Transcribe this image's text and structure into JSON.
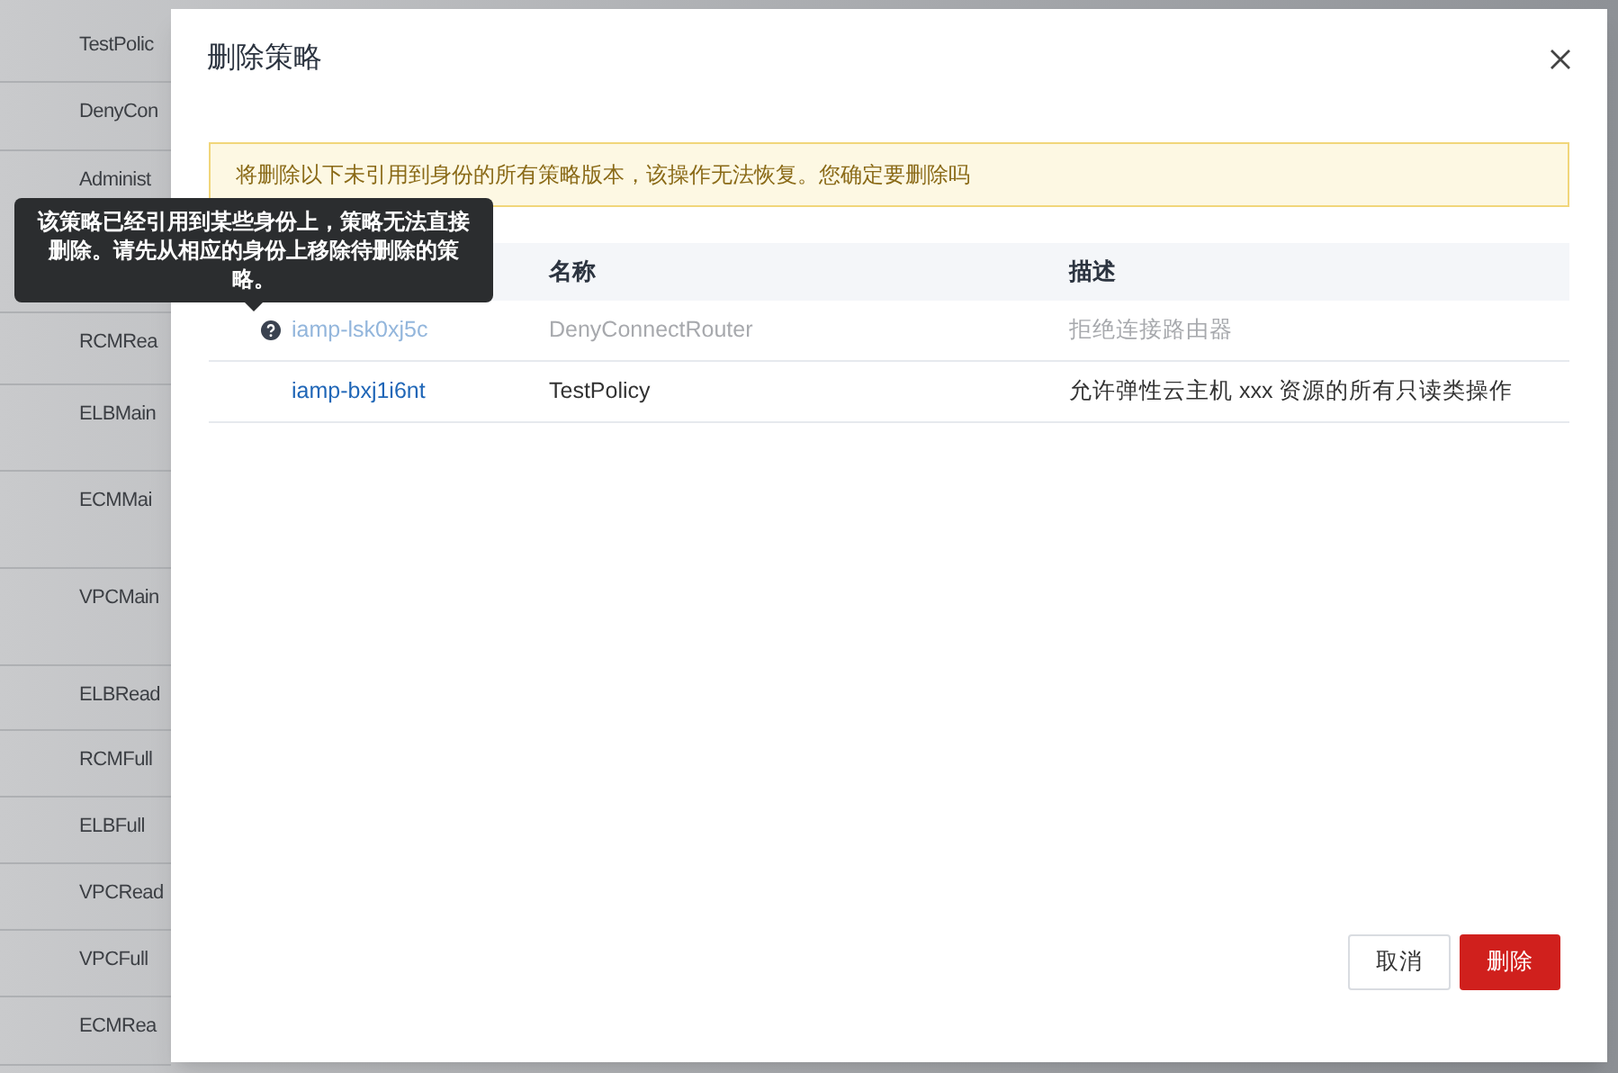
{
  "background_list": {
    "rows": [
      "TestPolic",
      "DenyCon",
      "Administ",
      "RCMRea",
      "ELBMain",
      "ECMMai",
      "VPCMain",
      "ELBRead",
      "RCMFull",
      "ELBFull",
      "VPCRead",
      "VPCFull",
      "ECMRea"
    ]
  },
  "dialog": {
    "title": "删除策略",
    "warning": "将删除以下未引用到身份的所有策略版本，该操作无法恢复。您确定要删除吗",
    "table": {
      "columns": [
        "名称",
        "描述"
      ],
      "rows": [
        {
          "id": "iamp-lsk0xj5c",
          "name": "DenyConnectRouter",
          "description": "拒绝连接路由器",
          "disabled": true
        },
        {
          "id": "iamp-bxj1i6nt",
          "name": "TestPolicy",
          "description": "允许弹性云主机 xxx 资源的所有只读类操作",
          "disabled": false
        }
      ]
    },
    "tooltip": "该策略已经引用到某些身份上，策略无法直接删除。请先从相应的身份上移除待删除的策略。",
    "buttons": [
      {
        "label": "取消",
        "kind": "secondary"
      },
      {
        "label": "删除",
        "kind": "danger"
      }
    ]
  }
}
